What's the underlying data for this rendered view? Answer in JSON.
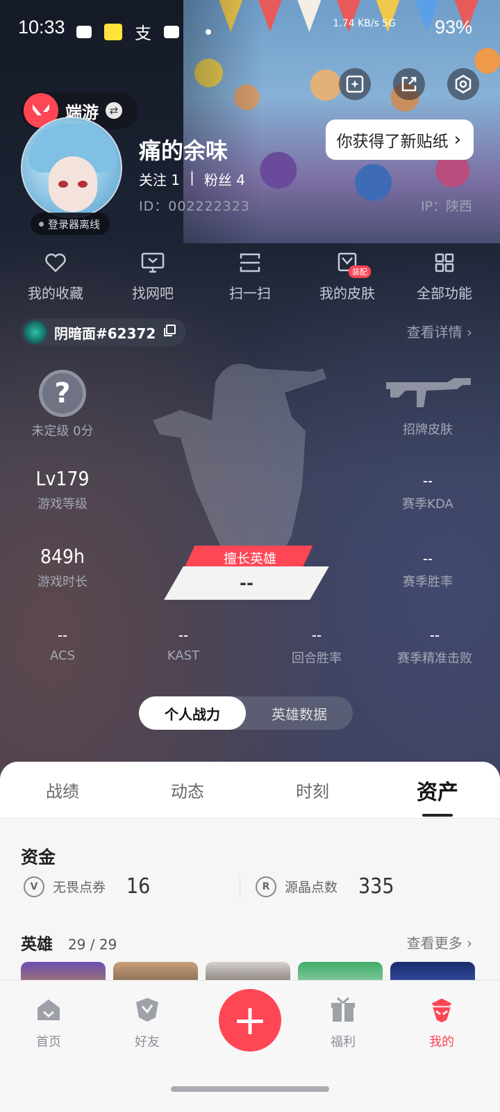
{
  "status_bar": {
    "time": "10:33",
    "network": "1.74 KB/s 5G",
    "battery": "93%",
    "icons": [
      "message-icon",
      "xianyu-app-icon",
      "alipay-icon",
      "mail-icon",
      "dot-icon"
    ]
  },
  "header": {
    "game_switch_label": "端游",
    "nickname": "痛的余味",
    "follow": "关注 1",
    "fans": "粉丝 4",
    "user_id": "ID：002222323",
    "ip": "IP：陕西",
    "online_status": "登录器离线",
    "sticker_notice": "你获得了新贴纸"
  },
  "functions": [
    {
      "label": "我的收藏",
      "icon": "heart-icon"
    },
    {
      "label": "找网吧",
      "icon": "monitor-icon"
    },
    {
      "label": "扫一扫",
      "icon": "scan-icon"
    },
    {
      "label": "我的皮肤",
      "icon": "skin-icon",
      "badge": "装配"
    },
    {
      "label": "全部功能",
      "icon": "grid-icon"
    }
  ],
  "game_account": {
    "name": "阴暗面#62372",
    "view_detail": "查看详情"
  },
  "stats": {
    "rank_label": "未定级 0分",
    "skin_label": "招牌皮肤",
    "level_value": "Lv179",
    "level_label": "游戏等级",
    "kda_value": "--",
    "kda_label": "赛季KDA",
    "hours_value": "849h",
    "hours_label": "游戏时长",
    "winrate_value": "--",
    "winrate_label": "赛季胜率",
    "acs_value": "--",
    "acs_label": "ACS",
    "kast_value": "--",
    "kast_label": "KAST",
    "round_win_value": "--",
    "round_win_label": "回合胜率",
    "precise_value": "--",
    "precise_label": "赛季精准击败",
    "best_hero_tag": "擅长英雄",
    "best_hero_value": "--"
  },
  "segment": {
    "left": "个人战力",
    "right": "英雄数据"
  },
  "tabs": [
    "战绩",
    "动态",
    "时刻",
    "资产"
  ],
  "assets": {
    "funds_title": "资金",
    "vp_label": "无畏点券",
    "vp_value": "16",
    "rp_label": "源晶点数",
    "rp_value": "335",
    "heroes_title": "英雄",
    "heroes_count": "29 / 29",
    "view_more": "查看更多"
  },
  "bottom_nav": [
    {
      "label": "首页",
      "icon": "home-icon"
    },
    {
      "label": "好友",
      "icon": "friends-icon"
    },
    {
      "label": "福利",
      "icon": "gift-icon"
    },
    {
      "label": "我的",
      "icon": "profile-icon"
    }
  ],
  "colors": {
    "accent": "#ff4655"
  }
}
